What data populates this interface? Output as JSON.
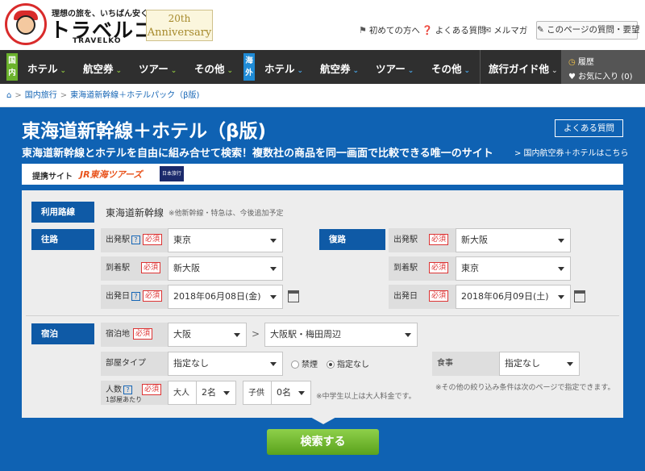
{
  "header": {
    "tagline": "理想の旅を、いちばん安く。",
    "brand": "トラベルコ",
    "brand_en": "TRAVELKO",
    "anniversary_1": "20th",
    "anniversary_2": "Anniversary",
    "links": [
      "初めての方へ",
      "よくある質問",
      "メルマガ"
    ],
    "question_btn": "このページの質問・要望"
  },
  "nav": {
    "domestic_tag": "国内",
    "overseas_tag": "海外",
    "domestic_items": [
      "ホテル",
      "航空券",
      "ツアー",
      "その他"
    ],
    "overseas_items": [
      "ホテル",
      "航空券",
      "ツアー",
      "その他"
    ],
    "guide": "旅行ガイド他",
    "history": "履歴",
    "favorites": "お気に入り (0)",
    "colors": {
      "domestic": "#6bb22c",
      "overseas": "#1f8bd6"
    }
  },
  "breadcrumb": [
    "国内旅行",
    "東海道新幹線＋ホテルパック（β版)"
  ],
  "page": {
    "title": "東海道新幹線＋ホテル（β版)",
    "faq": "よくある質問",
    "subtitle": "東海道新幹線とホテルを自由に組み合せて検索！複数社の商品を同一画面で比較できる唯一のサイト",
    "sublink": "> 国内航空券＋ホテルはこちら",
    "partner_label": "提携サイト",
    "partner_jr": "JR東海ツアーズ",
    "partner_ny": "日本旅行"
  },
  "form": {
    "route_label": "利用路線",
    "route_value": "東海道新幹線",
    "route_note": "※他新幹線・特急は、今後追加予定",
    "req": "必須",
    "outbound": {
      "label": "往路",
      "dep_label": "出発駅",
      "dep": "東京",
      "arr_label": "到着駅",
      "arr": "新大阪",
      "date_label": "出発日",
      "date": "2018年06月08日(金)"
    },
    "return": {
      "label": "復路",
      "dep_label": "出発駅",
      "dep": "新大阪",
      "arr_label": "到着駅",
      "arr": "東京",
      "date_label": "出発日",
      "date": "2018年06月09日(土)"
    },
    "stay": {
      "label": "宿泊",
      "area_label": "宿泊地",
      "area": "大阪",
      "sub_area": "大阪駅・梅田周辺",
      "room_label": "部屋タイプ",
      "room": "指定なし",
      "smoke_no": "禁煙",
      "smoke_any": "指定なし",
      "meal_label": "食事",
      "meal": "指定なし",
      "meal_note": "※その他の絞り込み条件は次のページで指定できます。",
      "people_label": "人数",
      "people_sub": "1部屋あたり",
      "adult_label": "大人",
      "adult": "2名",
      "child_label": "子供",
      "child": "0名",
      "child_note": "※中学生以上は大人料金です。"
    },
    "search_btn": "検索する"
  }
}
